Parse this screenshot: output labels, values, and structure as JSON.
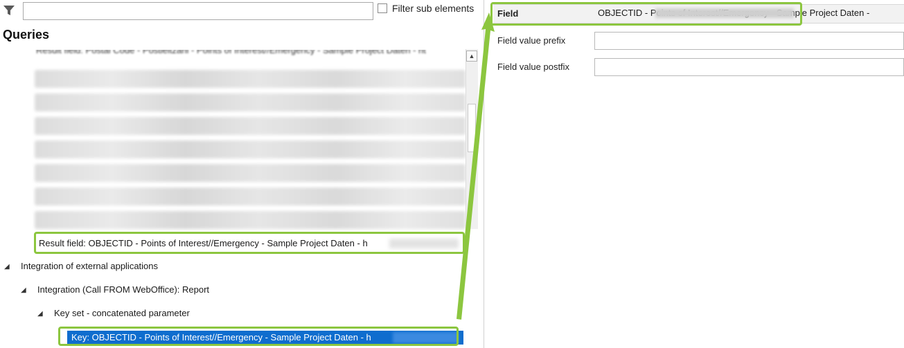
{
  "filter": {
    "input_value": "",
    "sub_elements_label": "Filter sub elements",
    "sub_elements_checked": false
  },
  "queries": {
    "title": "Queries",
    "top_partial_row": "Result field: Postal Code - Postleitzahl - Points of Interest//Emergency - Sample Project Daten - ht",
    "highlighted_row": "Result field: OBJECTID - Points of Interest//Emergency - Sample Project Daten - h"
  },
  "tree": {
    "integration_external": "Integration of external applications",
    "integration_call": "Integration (Call FROM WebOffice): Report",
    "key_set": "Key set - concatenated parameter",
    "selected_key": "Key: OBJECTID - Points of Interest//Emergency - Sample Project Daten - h"
  },
  "properties": {
    "field_label": "Field",
    "field_value": "OBJECTID - Points of Interest//Emergency - Sample Project Daten -",
    "prefix_label": "Field value prefix",
    "prefix_value": "",
    "postfix_label": "Field value postfix",
    "postfix_value": ""
  },
  "colors": {
    "highlight": "#8cc63f",
    "selection": "#0f6dce"
  }
}
